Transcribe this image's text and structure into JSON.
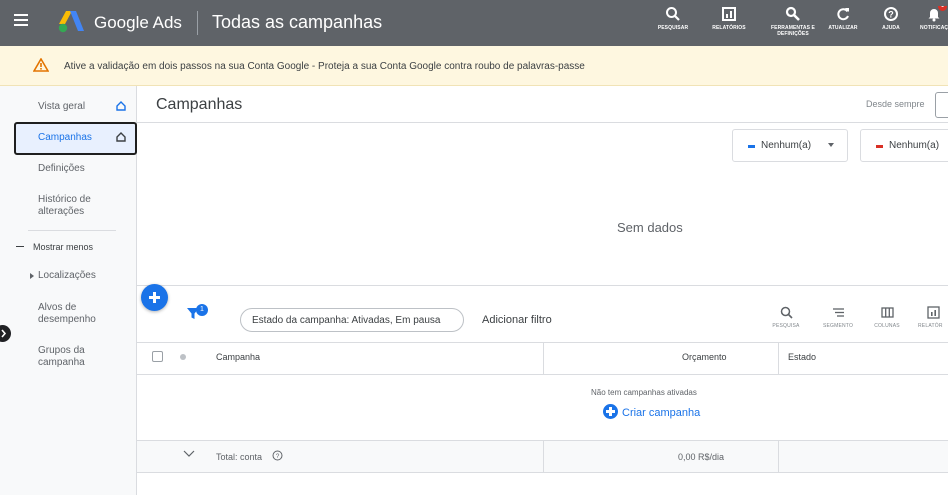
{
  "topbar": {
    "app_name": "Google Ads",
    "page_title": "Todas as campanhas",
    "actions": [
      {
        "label": "PESQUISAR",
        "icon": "search-icon"
      },
      {
        "label": "RELATÓRIOS",
        "icon": "reports-icon"
      },
      {
        "label_line1": "FERRAMENTAS E",
        "label_line2": "DEFINIÇÕES",
        "icon": "wrench-icon"
      },
      {
        "label": "ATUALIZAR",
        "icon": "refresh-icon"
      },
      {
        "label": "AJUDA",
        "icon": "help-icon"
      },
      {
        "label": "NOTIFICAÇ",
        "icon": "bell-icon",
        "badge": "1"
      }
    ]
  },
  "banner": {
    "text": "Ative a validação em dois passos na sua Conta Google - Proteja a sua Conta Google contra roubo de palavras-passe"
  },
  "sidebar": {
    "items": [
      {
        "label": "Vista geral"
      },
      {
        "label": "Campanhas"
      },
      {
        "label": "Definições"
      },
      {
        "label_line1": "Histórico de",
        "label_line2": "alterações"
      },
      {
        "label": "Mostrar menos"
      },
      {
        "label": "Localizações"
      },
      {
        "label_line1": "Alvos de",
        "label_line2": "desempenho"
      },
      {
        "label_line1": "Grupos da",
        "label_line2": "campanha"
      }
    ]
  },
  "main": {
    "title": "Campanhas",
    "date_range_label": "Desde sempre",
    "metric_selectors": [
      {
        "label": "Nenhum(a)",
        "color": "#1a73e8"
      },
      {
        "label": "Nenhum(a)",
        "color": "#d93025"
      }
    ],
    "no_data": "Sem dados",
    "filter_badge": "1",
    "filter_chip": "Estado da campanha: Ativadas, Em pausa",
    "add_filter": "Adicionar filtro",
    "tools": [
      {
        "label": "PESQUISA",
        "icon": "search-icon"
      },
      {
        "label": "SEGMENTO",
        "icon": "segment-icon"
      },
      {
        "label": "COLUNAS",
        "icon": "columns-icon"
      },
      {
        "label": "RELATÓR",
        "icon": "reports-icon"
      }
    ],
    "table": {
      "columns": [
        "Campanha",
        "Orçamento",
        "Estado"
      ],
      "empty_message": "Não tem campanhas ativadas",
      "create_label": "Criar campanha",
      "total_label": "Total: conta",
      "total_budget": "0,00 R$/dia"
    }
  },
  "colors": {
    "topbar": "#5f6368",
    "accent": "#1a73e8",
    "banner": "#fef7e0"
  }
}
